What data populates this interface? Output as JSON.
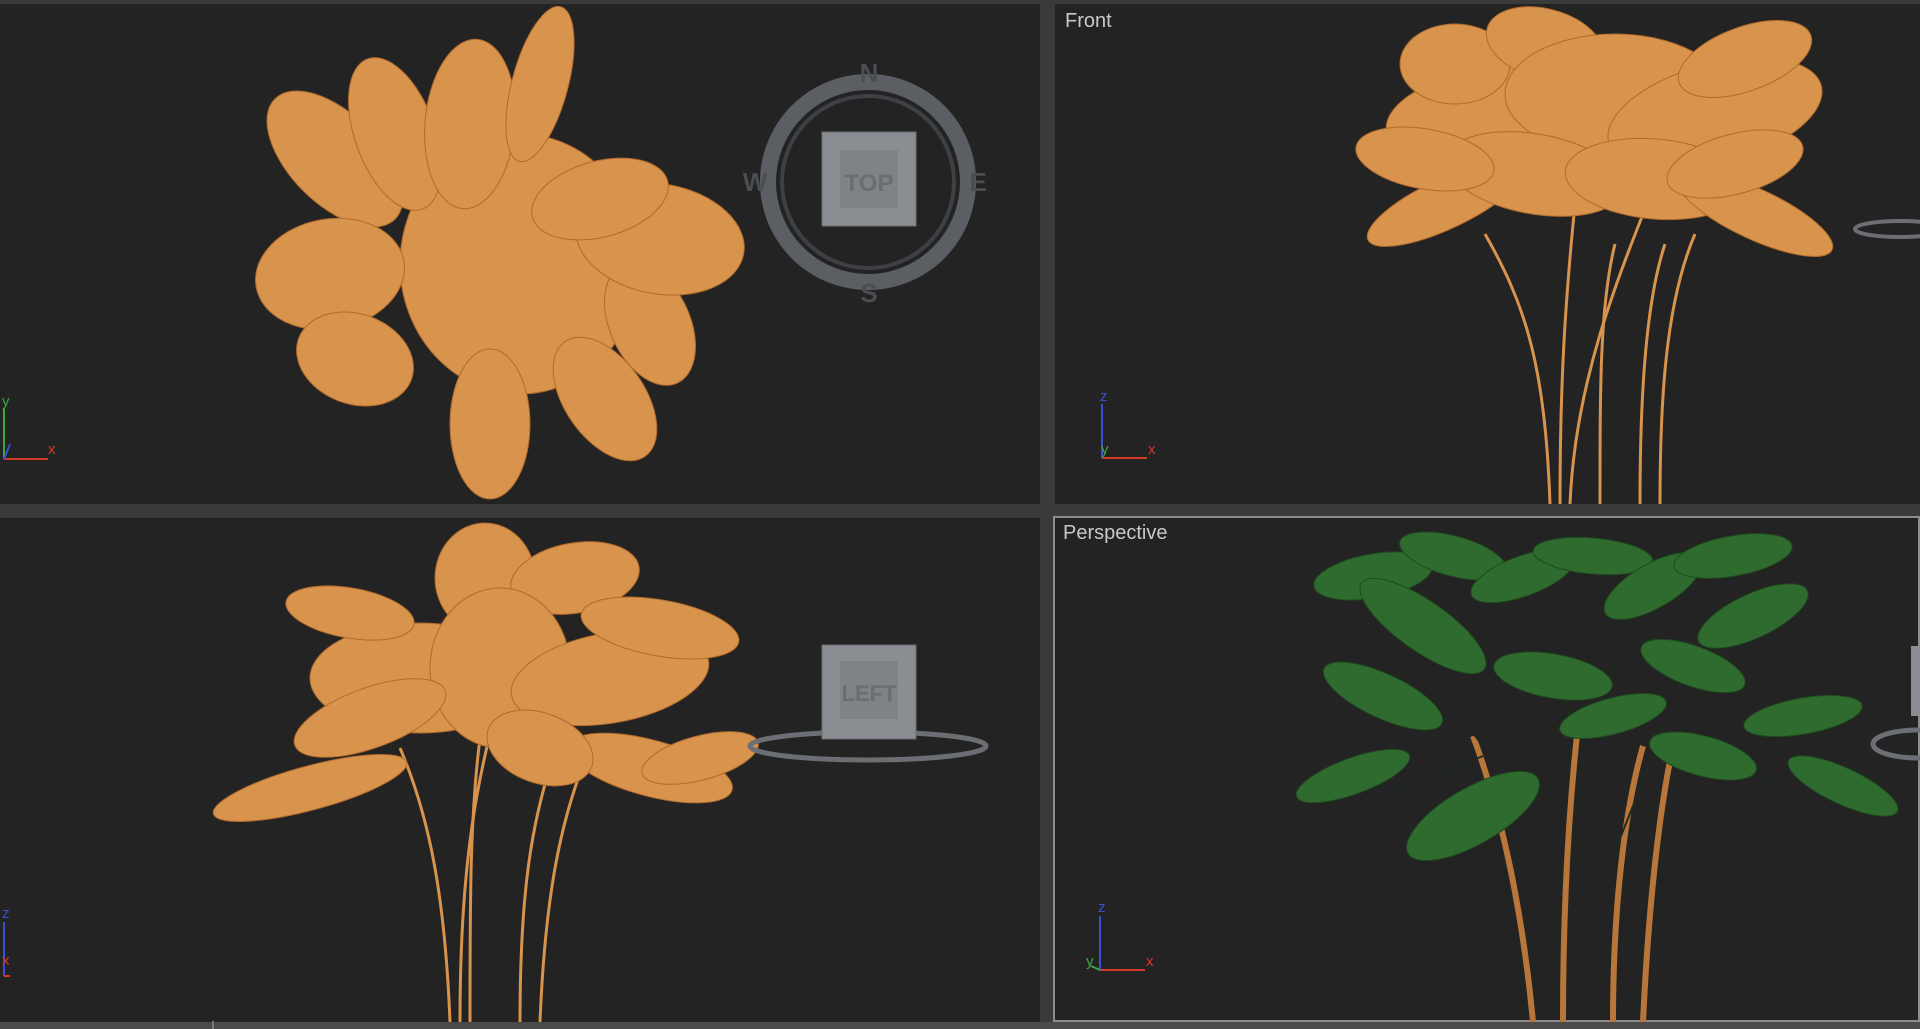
{
  "viewports": {
    "top": {
      "label": "",
      "viewcube_face": "TOP",
      "compass": {
        "n": "N",
        "s": "S",
        "e": "E",
        "w": "W"
      },
      "axis_labels": {
        "a": "y",
        "b": "x",
        "c": "z"
      }
    },
    "front": {
      "label": "Front",
      "axis_labels": {
        "up": "z",
        "right": "x",
        "depth": "y"
      }
    },
    "left": {
      "label": "",
      "viewcube_face": "LEFT",
      "axis_labels": {
        "up": "z",
        "right": "x"
      }
    },
    "perspective": {
      "label": "Perspective",
      "axis_labels": {
        "up": "z",
        "right": "x",
        "depth": "y"
      },
      "active": true
    }
  },
  "colors": {
    "viewport_bg": "#232323",
    "frame": "#3a3a3a",
    "wireframe": "#d8934c",
    "leaf_green": "#2f6b2e",
    "trunk": "#b8763a",
    "axis_x": "#d23a2a",
    "axis_y": "#3aa83a",
    "axis_z": "#3a4fd2"
  }
}
